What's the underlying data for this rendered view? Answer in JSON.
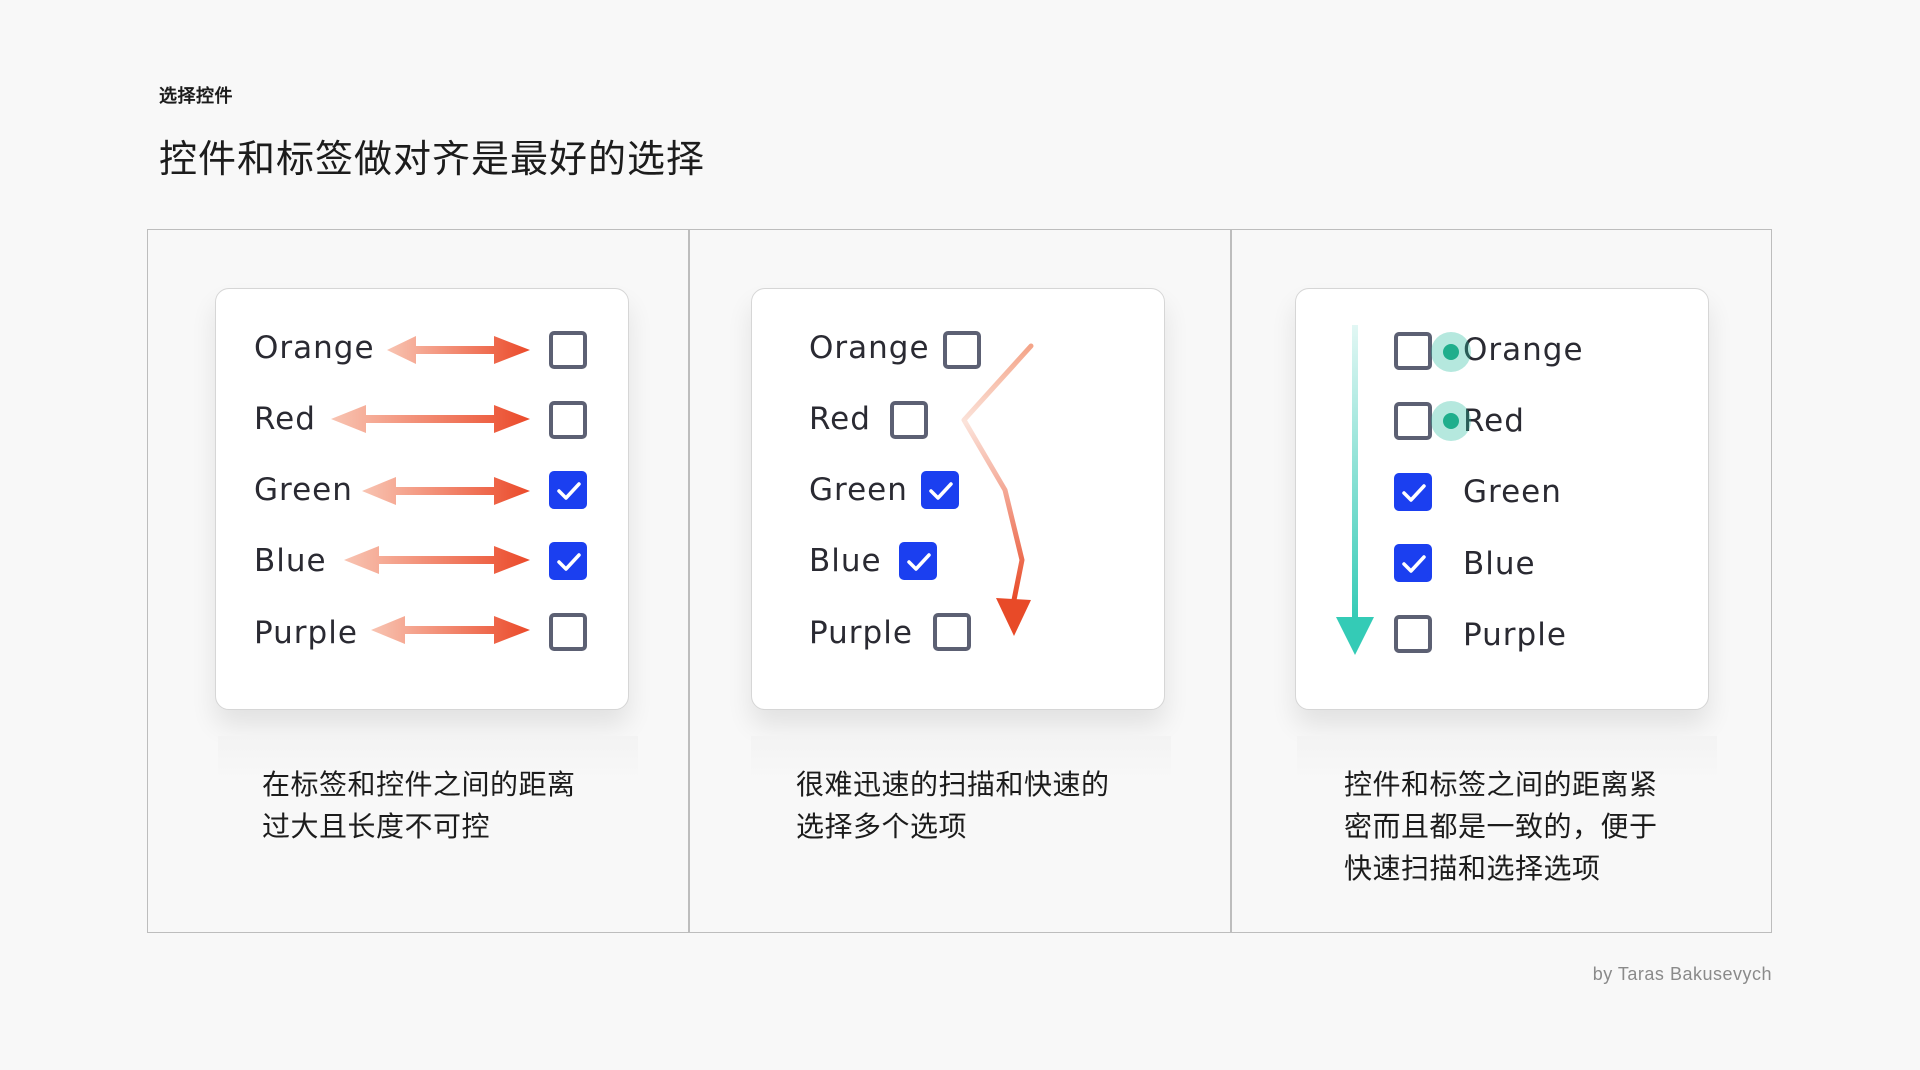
{
  "header": {
    "eyebrow": "选择控件",
    "title": "控件和标签做对齐是最好的选择"
  },
  "panels": [
    {
      "options": [
        {
          "label": "Orange",
          "checked": false
        },
        {
          "label": "Red",
          "checked": false
        },
        {
          "label": "Green",
          "checked": true
        },
        {
          "label": "Blue",
          "checked": true
        },
        {
          "label": "Purple",
          "checked": false
        }
      ],
      "caption": [
        "在标签和控件之间的距离",
        "过大且长度不可控"
      ]
    },
    {
      "options": [
        {
          "label": "Orange",
          "checked": false
        },
        {
          "label": "Red",
          "checked": false
        },
        {
          "label": "Green",
          "checked": true
        },
        {
          "label": "Blue",
          "checked": true
        },
        {
          "label": "Purple",
          "checked": false
        }
      ],
      "caption": [
        "很难迅速的扫描和快速的",
        "选择多个选项"
      ]
    },
    {
      "options": [
        {
          "label": "Orange",
          "checked": false
        },
        {
          "label": "Red",
          "checked": false
        },
        {
          "label": "Green",
          "checked": true
        },
        {
          "label": "Blue",
          "checked": true
        },
        {
          "label": "Purple",
          "checked": false
        }
      ],
      "caption": [
        "控件和标签之间的距离紧",
        "密而且都是一致的，便于",
        "快速扫描和选择选项"
      ]
    }
  ],
  "credit": "by Taras Bakusevych",
  "colors": {
    "checkbox_checked": "#1b3ff0",
    "checkbox_border": "#5c6073",
    "arrow_red": "#ec5433",
    "arrow_light": "#f6b9a4",
    "guide_teal": "#3dcfbd",
    "dot_teal": "#1fae8c"
  }
}
